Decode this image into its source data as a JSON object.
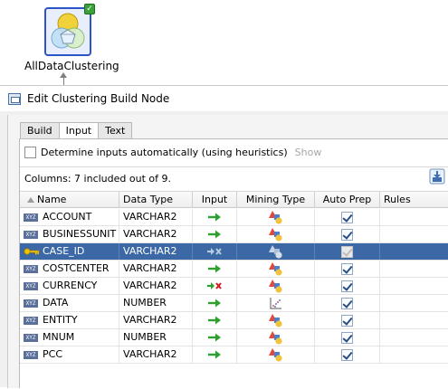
{
  "node": {
    "label": "AllDataClustering",
    "icon": "clustering-node-icon",
    "status_icon": "check-badge-icon"
  },
  "dialog": {
    "title": "Edit Clustering Build Node"
  },
  "tabs": [
    {
      "label": "Build",
      "active": false
    },
    {
      "label": "Input",
      "active": true
    },
    {
      "label": "Text",
      "active": false
    }
  ],
  "input_panel": {
    "heuristics_label": "Determine inputs automatically (using heuristics)",
    "heuristics_checked": false,
    "show_link": "Show",
    "columns_summary": "Columns: 7 included out of 9."
  },
  "table": {
    "headers": {
      "name": "Name",
      "data_type": "Data Type",
      "input": "Input",
      "mining_type": "Mining Type",
      "auto_prep": "Auto Prep",
      "rules": "Rules"
    },
    "rows": [
      {
        "name": "ACCOUNT",
        "type_icon": "varchar-icon",
        "data_type": "VARCHAR2",
        "input": "include-arrow-icon",
        "mining": "categorical-icon",
        "auto_prep": true,
        "selected": false
      },
      {
        "name": "BUSINESSUNIT",
        "type_icon": "varchar-icon",
        "data_type": "VARCHAR2",
        "input": "include-arrow-icon",
        "mining": "categorical-icon",
        "auto_prep": true,
        "selected": false
      },
      {
        "name": "CASE_ID",
        "type_icon": "key-icon",
        "data_type": "VARCHAR2",
        "input": "exclude-arrow-icon",
        "mining": "categorical-icon",
        "auto_prep": true,
        "selected": true
      },
      {
        "name": "COSTCENTER",
        "type_icon": "varchar-icon",
        "data_type": "VARCHAR2",
        "input": "include-arrow-icon",
        "mining": "categorical-icon",
        "auto_prep": true,
        "selected": false
      },
      {
        "name": "CURRENCY",
        "type_icon": "varchar-icon",
        "data_type": "VARCHAR2",
        "input": "exclude-arrow-icon",
        "mining": "categorical-icon",
        "auto_prep": true,
        "selected": false
      },
      {
        "name": "DATA",
        "type_icon": "varchar-icon",
        "data_type": "NUMBER",
        "input": "include-arrow-icon",
        "mining": "numerical-icon",
        "auto_prep": true,
        "selected": false
      },
      {
        "name": "ENTITY",
        "type_icon": "varchar-icon",
        "data_type": "VARCHAR2",
        "input": "include-arrow-icon",
        "mining": "categorical-icon",
        "auto_prep": true,
        "selected": false
      },
      {
        "name": "MNUM",
        "type_icon": "varchar-icon",
        "data_type": "NUMBER",
        "input": "include-arrow-icon",
        "mining": "categorical-icon",
        "auto_prep": true,
        "selected": false
      },
      {
        "name": "PCC",
        "type_icon": "varchar-icon",
        "data_type": "VARCHAR2",
        "input": "include-arrow-icon",
        "mining": "categorical-icon",
        "auto_prep": true,
        "selected": false
      }
    ]
  },
  "colors": {
    "selection": "#3c69a5",
    "include_arrow": "#2ea02e",
    "exclude_mark": "#d02020",
    "node_border": "#2b55c8"
  }
}
